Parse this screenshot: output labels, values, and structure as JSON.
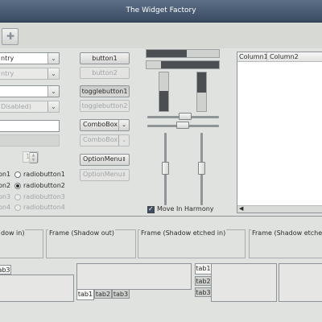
{
  "window": {
    "title": "The Widget Factory"
  },
  "toolbar": {
    "button_icon": "plus-icon"
  },
  "left": {
    "combo_entry": "ntry",
    "combo_entry_disabled": "ntry",
    "combo_disabled": "Disabled)",
    "spin_value": "1",
    "radios_left": [
      "on1",
      "on2",
      "on3",
      "on4"
    ],
    "radios_right": [
      "radiobutton1",
      "radiobutton2",
      "radiobutton3",
      "radiobutton4"
    ]
  },
  "buttons": {
    "button1": "button1",
    "button2": "button2",
    "togglebutton1": "togglebutton1",
    "togglebutton2": "togglebutton2",
    "combobox": "ComboBox",
    "combobox_disabled": "ComboBox",
    "optionmenu": "OptionMenu",
    "optionmenu_disabled": "OptionMenu"
  },
  "scales": {
    "move_in_harmony": "Move In Harmony",
    "progress_top": 0.55,
    "progress_bottom": 0.8
  },
  "tree": {
    "columns": [
      "Column1",
      "Column2"
    ]
  },
  "frames": [
    "dow in)",
    "Frame (Shadow out)",
    "Frame (Shadow etched in)",
    "Frame (Shadow etche"
  ],
  "tabs": {
    "left": [
      "ab3"
    ],
    "middle": [
      "tab1",
      "tab2",
      "tab3"
    ],
    "right": [
      "tab1",
      "tab2",
      "tab3"
    ]
  },
  "colors": {
    "titlebar": "#4a5c74",
    "progress_fill": "#4b4f52"
  }
}
